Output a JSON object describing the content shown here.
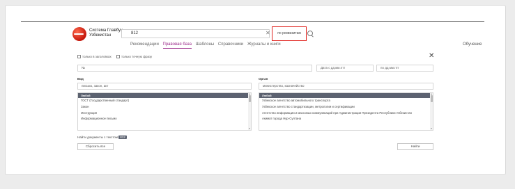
{
  "header": {
    "logo": {
      "line1": "Система Главбух",
      "line2": "Узбекистан"
    },
    "search": {
      "value": "812"
    },
    "requisites_button": "по реквизитам",
    "tabs": [
      {
        "label": "Рекомендации",
        "active": false
      },
      {
        "label": "Правовая база",
        "active": true
      },
      {
        "label": "Шаблоны",
        "active": false
      },
      {
        "label": "Справочники",
        "active": false
      },
      {
        "label": "Журналы и книги",
        "active": false
      }
    ],
    "learning_link": "Обучение"
  },
  "form": {
    "checkbox_in_titles": "только в заголовках",
    "checkbox_exact_phrase": "только точную фразу",
    "number_field": "№",
    "date_from": "Дата с  дд.мм.гггг",
    "date_to": "по  дд.мм.гггг",
    "type_label": "Вид",
    "type_filter": "письмо, закон, акт",
    "organ_label": "Орган",
    "organ_filter": "министерство, казначейство",
    "type_list": {
      "header": "Любой",
      "items": [
        "ГОСТ (Государственный стандарт)",
        "Закон",
        "Инструкция",
        "Информационное письмо"
      ]
    },
    "organ_list": {
      "header": "Любой",
      "items": [
        "Узбекское агентство автомобильного транспорта",
        "Узбекское агентство стандартизации, метрологии и сертификации",
        "Агентство информации и массовых коммуникаций при Администрации Президента Республики Узбекистан",
        "Акимат города Нур-Султана"
      ]
    },
    "found_text": "Найти документы с текстом",
    "found_count": "812",
    "reset_button": "Сбросить все",
    "search_button": "Найти"
  },
  "colors": {
    "accent_purple": "#9b2a8a",
    "highlight_red": "#e0211c",
    "list_header": "#5c6270"
  }
}
